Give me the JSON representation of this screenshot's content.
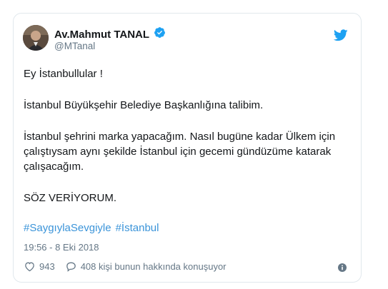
{
  "author": {
    "name": "Av.Mahmut TANAL",
    "handle": "@MTanal"
  },
  "tweet": {
    "paragraph1": "Ey İstanbullular !",
    "paragraph2": "İstanbul Büyükşehir Belediye Başkanlığına talibim.",
    "paragraph3": "İstanbul şehrini marka yapacağım. Nasıl bugüne kadar Ülkem için çalıştıysam aynı şekilde İstanbul için gecemi gündüzüme katarak çalışacağım.",
    "paragraph4": "SÖZ VERİYORUM.",
    "hashtags": [
      "#SaygıylaSevgiyle",
      "#İstanbul"
    ],
    "timestamp": "19:56 - 8 Eki 2018"
  },
  "actions": {
    "likes": "943",
    "conversation": "408 kişi bunun hakkında konuşuyor"
  },
  "colors": {
    "accent": "#1da1f2",
    "link": "#3b94d9",
    "muted": "#657786"
  },
  "icons": [
    "verified-badge-icon",
    "twitter-bird-icon",
    "heart-icon",
    "reply-icon",
    "info-icon"
  ]
}
